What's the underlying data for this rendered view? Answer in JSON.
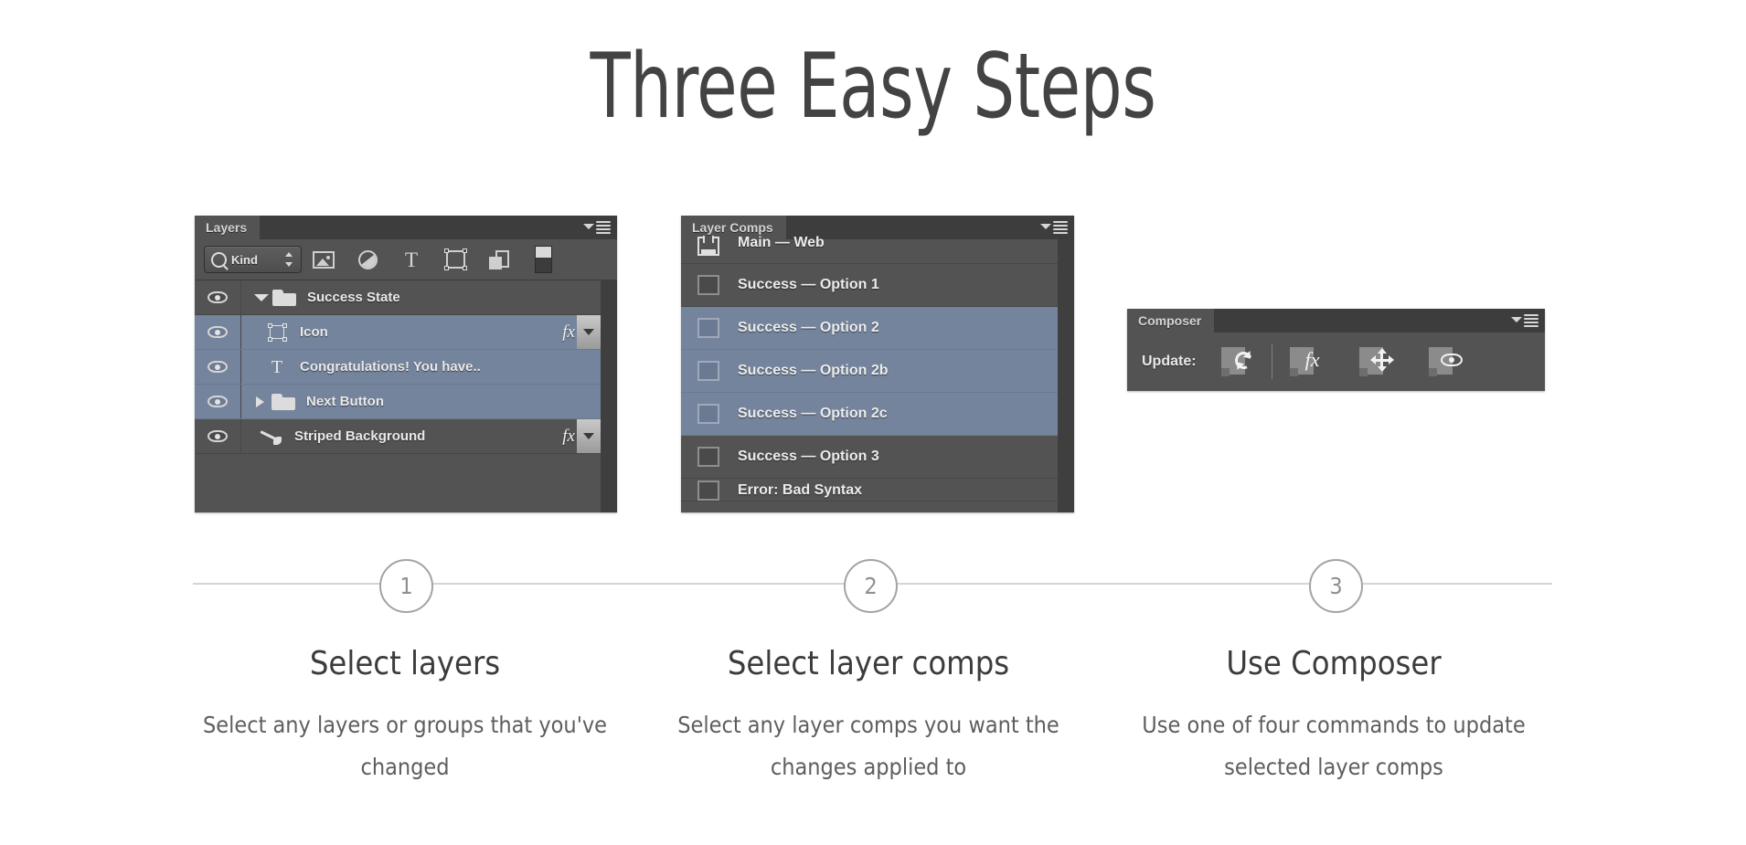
{
  "page": {
    "title": "Three Easy Steps",
    "background_color": "#ffffff",
    "heading_color": "#434343",
    "line_color": "#d5d5d5",
    "selection_color": "#74849c",
    "panel_color": "#535353"
  },
  "layers_panel": {
    "tab_label": "Layers",
    "menu_icon": "panel-menu-icon",
    "filter": {
      "search_icon": "magnifier-icon",
      "kind_label": "Kind",
      "stepper_icon": "stepper-updown-icon"
    },
    "filter_icons": [
      {
        "name": "pixel-layers-filter-icon"
      },
      {
        "name": "adjustment-layers-filter-icon"
      },
      {
        "name": "type-layers-filter-icon"
      },
      {
        "name": "shape-layers-filter-icon"
      },
      {
        "name": "smart-object-filter-icon"
      },
      {
        "name": "filter-toggle-switch-icon"
      }
    ],
    "rows": [
      {
        "label": "Success State",
        "icon": "folder-icon",
        "disclosure": "open",
        "selected": false,
        "fx": false
      },
      {
        "label": "Icon",
        "icon": "shape-icon",
        "disclosure": "none",
        "selected": true,
        "fx": true
      },
      {
        "label": "Congratulations! You have..",
        "icon": "type-icon",
        "disclosure": "none",
        "selected": true,
        "fx": false
      },
      {
        "label": "Next Button",
        "icon": "folder-icon",
        "disclosure": "closed",
        "selected": true,
        "fx": false
      },
      {
        "label": "Striped Background",
        "icon": "brush-icon",
        "disclosure": "none",
        "selected": false,
        "fx": true
      }
    ],
    "fx_label": "fx",
    "eye_icon": "visibility-eye-icon"
  },
  "layer_comps_panel": {
    "tab_label": "Layer Comps",
    "menu_icon": "panel-menu-icon",
    "rows": [
      {
        "label": "Main — Web",
        "icon": "last-document-state-icon",
        "selected": false,
        "clip": "top"
      },
      {
        "label": "Success — Option 1",
        "icon": "comp-checkbox-icon",
        "selected": false,
        "clip": "none"
      },
      {
        "label": "Success — Option 2",
        "icon": "comp-checkbox-icon",
        "selected": true,
        "clip": "none"
      },
      {
        "label": "Success — Option 2b",
        "icon": "comp-checkbox-icon",
        "selected": true,
        "clip": "none"
      },
      {
        "label": "Success — Option 2c",
        "icon": "comp-checkbox-icon",
        "selected": true,
        "clip": "none"
      },
      {
        "label": "Success — Option 3",
        "icon": "comp-checkbox-icon",
        "selected": false,
        "clip": "none"
      },
      {
        "label": "Error: Bad Syntax",
        "icon": "comp-checkbox-icon",
        "selected": false,
        "clip": "bottom"
      }
    ]
  },
  "composer_panel": {
    "tab_label": "Composer",
    "menu_icon": "panel-menu-icon",
    "update_label": "Update:",
    "commands": [
      {
        "name": "update-all-button",
        "icon": "refresh-icon"
      },
      {
        "name": "update-appearance-button",
        "icon": "fx-icon"
      },
      {
        "name": "update-position-button",
        "icon": "move-icon"
      },
      {
        "name": "update-visibility-button",
        "icon": "eye-icon"
      }
    ]
  },
  "steps": [
    {
      "number": "1",
      "title": "Select layers",
      "description": "Select any layers or groups that you've changed"
    },
    {
      "number": "2",
      "title": "Select layer comps",
      "description": "Select any layer comps you want the changes applied to"
    },
    {
      "number": "3",
      "title": "Use Composer",
      "description": "Use one of four commands to update selected layer comps"
    }
  ]
}
